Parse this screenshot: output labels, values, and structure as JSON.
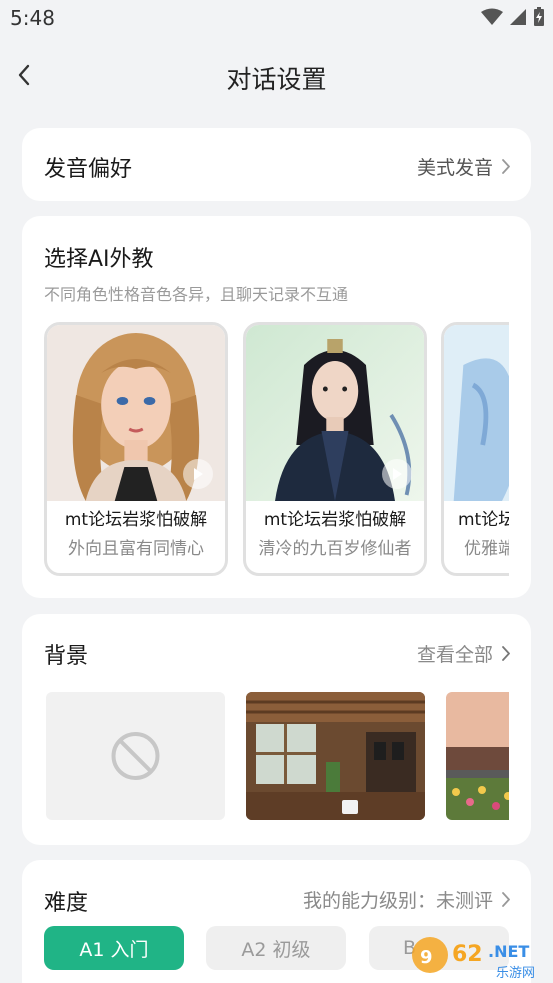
{
  "status": {
    "time": "5:48"
  },
  "header": {
    "title": "对话设置"
  },
  "pronunciation": {
    "label": "发音偏好",
    "value": "美式发音"
  },
  "tutors": {
    "title": "选择AI外教",
    "subtitle": "不同角色性格音色各异，且聊天记录不互通",
    "items": [
      {
        "name": "mt论坛岩浆怕破解",
        "desc": "外向且富有同情心"
      },
      {
        "name": "mt论坛岩浆怕破解",
        "desc": "清冷的九百岁修仙者"
      },
      {
        "name": "mt论坛",
        "desc": "优雅端"
      }
    ]
  },
  "background": {
    "title": "背景",
    "view_all": "查看全部",
    "tiles": [
      "none-icon",
      "cafe-scene",
      "railway-flowers-scene"
    ]
  },
  "difficulty": {
    "title": "难度",
    "ability_label": "我的能力级别：未测评",
    "levels": [
      {
        "label": "A1 入门",
        "selected": true
      },
      {
        "label": "A2 初级",
        "selected": false
      },
      {
        "label": "B",
        "selected": false
      }
    ]
  },
  "watermark": {
    "text": "962.NET",
    "sub": "乐游网"
  },
  "colors": {
    "accent": "#20b486",
    "page_bg": "#f2f3f5"
  }
}
